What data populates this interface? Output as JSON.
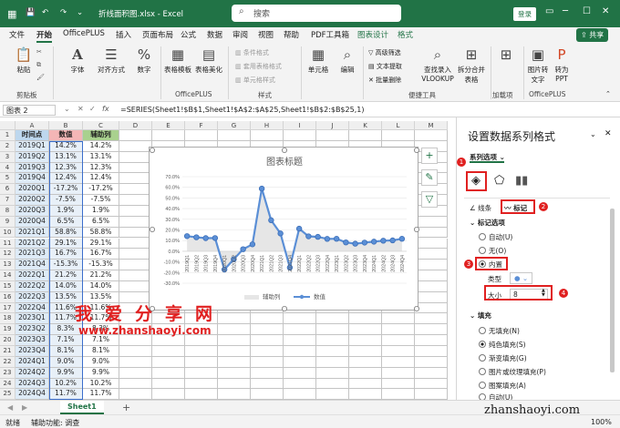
{
  "titlebar": {
    "filename": "折线面积图.xlsx - Excel",
    "search_placeholder": "搜索",
    "login": "登录",
    "bg": "#217346"
  },
  "tabs": [
    "文件",
    "开始",
    "OfficePLUS",
    "插入",
    "页面布局",
    "公式",
    "数据",
    "审阅",
    "视图",
    "帮助",
    "PDF工具箱",
    "图表设计",
    "格式"
  ],
  "share_label": "共享",
  "ribbon": {
    "paste": "粘贴",
    "font": "字体",
    "align": "对齐方式",
    "number": "数字",
    "tpl": "表格模板",
    "beautify": "表格美化",
    "cf": "条件格式",
    "table_fmt": "套用表格格式",
    "cell_style": "单元格样式",
    "cells": "单元格",
    "edit": "编辑",
    "adv_filter": "高级筛选",
    "text_extract": "文本提取",
    "batch_delete": "批量删除",
    "lookup": "查找录入\nVLOOKUP",
    "split": "拆分合并\n表格",
    "load": "加载项",
    "convert": "图片转\n文字",
    "to_ppt": "转为\nPPT",
    "groups": [
      "剪贴板",
      "OfficePLUS",
      "样式",
      "便捷工具",
      "加载项",
      "OfficePLUS"
    ]
  },
  "formula_bar": {
    "name": "图表 2",
    "fx": "fx",
    "formula": "=SERIES(Sheet1!$B$1,Sheet1!$A$2:$A$25,Sheet1!$B$2:$B$25,1)"
  },
  "columns": [
    "A",
    "B",
    "C",
    "D",
    "E",
    "F",
    "G",
    "H",
    "I",
    "J",
    "K",
    "L",
    "M"
  ],
  "headers": [
    "时间点",
    "数值",
    "辅助列"
  ],
  "rows": [
    [
      "2019Q1",
      "14.2%",
      "14.2%"
    ],
    [
      "2019Q2",
      "13.1%",
      "13.1%"
    ],
    [
      "2019Q3",
      "12.3%",
      "12.3%"
    ],
    [
      "2019Q4",
      "12.4%",
      "12.4%"
    ],
    [
      "2020Q1",
      "-17.2%",
      "-17.2%"
    ],
    [
      "2020Q2",
      "-7.5%",
      "-7.5%"
    ],
    [
      "2020Q3",
      "1.9%",
      "1.9%"
    ],
    [
      "2020Q4",
      "6.5%",
      "6.5%"
    ],
    [
      "2021Q1",
      "58.8%",
      "58.8%"
    ],
    [
      "2021Q2",
      "29.1%",
      "29.1%"
    ],
    [
      "2021Q3",
      "16.7%",
      "16.7%"
    ],
    [
      "2021Q4",
      "-15.3%",
      "-15.3%"
    ],
    [
      "2022Q1",
      "21.2%",
      "21.2%"
    ],
    [
      "2022Q2",
      "14.0%",
      "14.0%"
    ],
    [
      "2022Q3",
      "13.5%",
      "13.5%"
    ],
    [
      "2022Q4",
      "11.6%",
      "11.6%"
    ],
    [
      "2023Q1",
      "11.7%",
      "11.7%"
    ],
    [
      "2023Q2",
      "8.3%",
      "8.3%"
    ],
    [
      "2023Q3",
      "7.1%",
      "7.1%"
    ],
    [
      "2023Q4",
      "8.1%",
      "8.1%"
    ],
    [
      "2024Q1",
      "9.0%",
      "9.0%"
    ],
    [
      "2024Q2",
      "9.9%",
      "9.9%"
    ],
    [
      "2024Q3",
      "10.2%",
      "10.2%"
    ],
    [
      "2024Q4",
      "11.7%",
      "11.7%"
    ]
  ],
  "chart_data": {
    "type": "line",
    "title": "图表标题",
    "categories": [
      "2019Q1",
      "2019Q2",
      "2019Q3",
      "2019Q4",
      "2020Q1",
      "2020Q2",
      "2020Q3",
      "2020Q4",
      "2021Q1",
      "2021Q2",
      "2021Q3",
      "2021Q4",
      "2022Q1",
      "2022Q2",
      "2022Q3",
      "2022Q4",
      "2023Q1",
      "2023Q2",
      "2023Q3",
      "2023Q4",
      "2024Q1",
      "2024Q2",
      "2024Q3",
      "2024Q4"
    ],
    "series": [
      {
        "name": "辅助列",
        "type": "area",
        "color": "#e6e6e6",
        "values": [
          14.2,
          13.1,
          12.3,
          12.4,
          -17.2,
          -7.5,
          1.9,
          6.5,
          58.8,
          29.1,
          16.7,
          -15.3,
          21.2,
          14.0,
          13.5,
          11.6,
          11.7,
          8.3,
          7.1,
          8.1,
          9.0,
          9.9,
          10.2,
          11.7
        ]
      },
      {
        "name": "数值",
        "type": "line",
        "color": "#5b8fd6",
        "values": [
          14.2,
          13.1,
          12.3,
          12.4,
          -17.2,
          -7.5,
          1.9,
          6.5,
          58.8,
          29.1,
          16.7,
          -15.3,
          21.2,
          14.0,
          13.5,
          11.6,
          11.7,
          8.3,
          7.1,
          8.1,
          9.0,
          9.9,
          10.2,
          11.7
        ]
      }
    ],
    "yticks": [
      "70.0%",
      "60.0%",
      "50.0%",
      "40.0%",
      "30.0%",
      "20.0%",
      "10.0%",
      "0.0%",
      "-10.0%",
      "-20.0%",
      "-30.0%"
    ],
    "ylim": [
      -30,
      70
    ],
    "legend": "bottom"
  },
  "pane": {
    "title": "设置数据系列格式",
    "series_options": "系列选项",
    "tab_line": "线条",
    "tab_marker": "标记",
    "marker_options": "标记选项",
    "opt_auto": "自动(U)",
    "opt_none": "无(O)",
    "opt_builtin": "内置",
    "type_label": "类型",
    "size_label": "大小",
    "size_value": "8",
    "fill": "填充",
    "fill_options": [
      "无填充(N)",
      "纯色填充(S)",
      "渐变填充(G)",
      "图片或纹理填充(P)",
      "图案填充(A)",
      "自动(U)"
    ],
    "badges": [
      "1",
      "2",
      "3",
      "4"
    ]
  },
  "sheet_tab": "Sheet1",
  "status": {
    "ready": "就绪",
    "accessibility": "辅助功能: 调查",
    "zoom": "100%"
  },
  "watermark": {
    "line1": "我爱分享网",
    "line2": "www.zhanshaoyi.com",
    "line3": "zhanshaoyi.com"
  }
}
